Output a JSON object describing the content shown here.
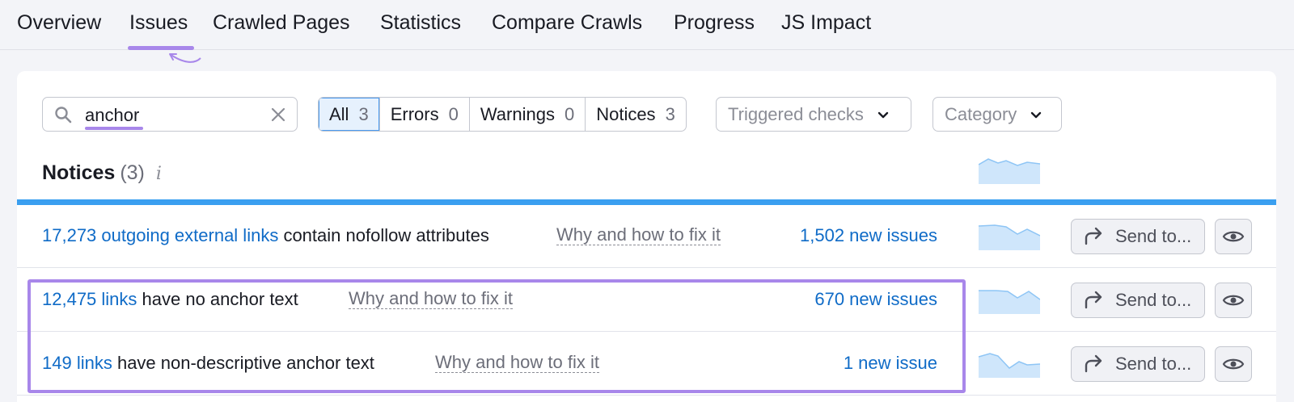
{
  "tabs": [
    {
      "label": "Overview"
    },
    {
      "label": "Issues",
      "active": true
    },
    {
      "label": "Crawled Pages"
    },
    {
      "label": "Statistics"
    },
    {
      "label": "Compare Crawls"
    },
    {
      "label": "Progress"
    },
    {
      "label": "JS Impact"
    }
  ],
  "search": {
    "value": "anchor",
    "icon": "search-icon",
    "clear_icon": "close-icon"
  },
  "filters": [
    {
      "label": "All",
      "count": "3",
      "active": true
    },
    {
      "label": "Errors",
      "count": "0"
    },
    {
      "label": "Warnings",
      "count": "0"
    },
    {
      "label": "Notices",
      "count": "3"
    }
  ],
  "dropdowns": {
    "triggered": {
      "label": "Triggered checks"
    },
    "category": {
      "label": "Category"
    }
  },
  "notices": {
    "title": "Notices",
    "count": "(3)",
    "info_icon": "i"
  },
  "rows": [
    {
      "link": "17,273 outgoing external links",
      "text": " contain nofollow attributes",
      "why": "Why and how to fix it",
      "new_issues": "1,502 new issues",
      "send_label": "Send to..."
    },
    {
      "link": "12,475 links",
      "text": " have no anchor text",
      "why": "Why and how to fix it",
      "new_issues": "670 new issues",
      "send_label": "Send to..."
    },
    {
      "link": "149 links",
      "text": " have non-descriptive anchor text",
      "why": "Why and how to fix it",
      "new_issues": "1 new issue",
      "send_label": "Send to..."
    }
  ],
  "colors": {
    "accent": "#a887ea",
    "link": "#0f6bc7",
    "bar": "#3a9ff0",
    "spark_fill": "#cfe6fb"
  }
}
